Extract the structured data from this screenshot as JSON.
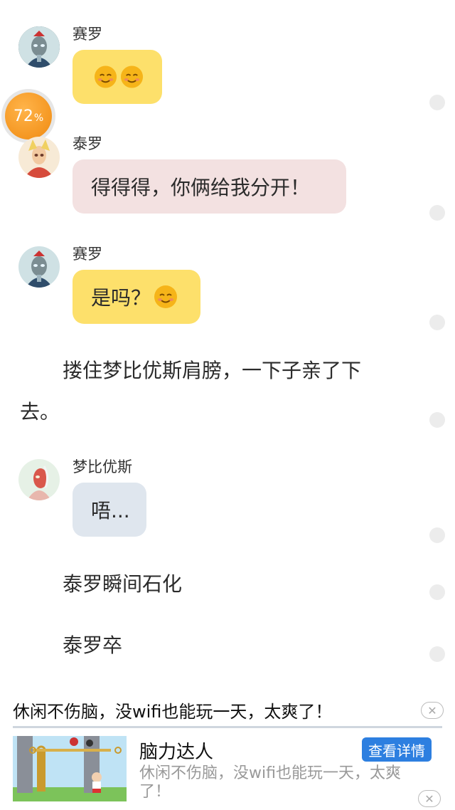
{
  "messages": [
    {
      "speaker": "赛罗",
      "text": "",
      "emoji_count": 2,
      "color": "#fde06b",
      "avatar": "zero-avatar"
    },
    {
      "speaker": "泰罗",
      "text": "得得得，你俩给我分开！",
      "emoji_count": 0,
      "color": "#f3e1e1",
      "avatar": "taro-avatar"
    },
    {
      "speaker": "赛罗",
      "text": "是吗？",
      "emoji_count": 1,
      "color": "#fde06b",
      "avatar": "zero-avatar"
    },
    {
      "speaker": "梦比优斯",
      "text": "唔...",
      "emoji_count": 0,
      "color": "#dfe6ee",
      "avatar": "mebius-avatar"
    }
  ],
  "narration": [
    "搂住梦比优斯肩膀，一下子亲了下",
    "去。",
    "泰罗瞬间石化",
    "泰罗卒"
  ],
  "progress": {
    "value": "72",
    "unit": "%"
  },
  "ad": {
    "headline": "休闲不伤脑，没wifi也能玩一天，太爽了！",
    "app_name": "脑力达人",
    "cta": "查看详情",
    "description": "休闲不伤脑，没wifi也能玩一天，太爽了！",
    "close_symbol": "✕"
  }
}
